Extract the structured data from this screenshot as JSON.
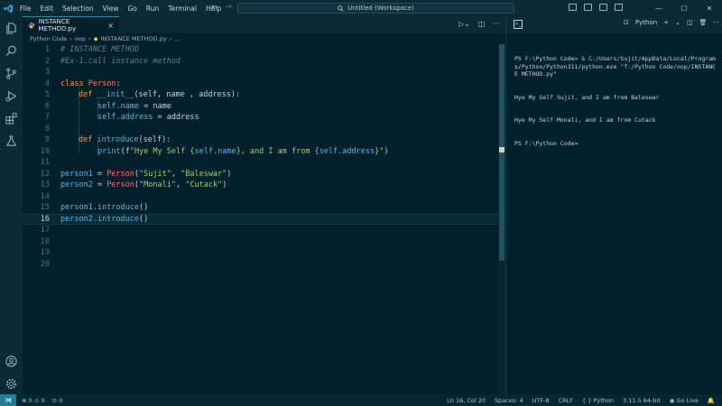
{
  "menu": [
    "File",
    "Edit",
    "Selection",
    "View",
    "Go",
    "Run",
    "Terminal",
    "Help"
  ],
  "command_center": "Untitled (Workspace)",
  "tab": {
    "label": "INSTANCE METHOD.py",
    "close": "×"
  },
  "breadcrumb": [
    "Python Code",
    "oop",
    "INSTANCE METHOD.py",
    "..."
  ],
  "code_lines": [
    {
      "n": "1"
    },
    {
      "n": "2"
    },
    {
      "n": "3"
    },
    {
      "n": "4"
    },
    {
      "n": "5"
    },
    {
      "n": "6"
    },
    {
      "n": "7"
    },
    {
      "n": "8"
    },
    {
      "n": "9"
    },
    {
      "n": "10"
    },
    {
      "n": "11"
    },
    {
      "n": "12"
    },
    {
      "n": "13"
    },
    {
      "n": "14"
    },
    {
      "n": "15"
    },
    {
      "n": "16"
    },
    {
      "n": "17"
    },
    {
      "n": "18"
    },
    {
      "n": "19"
    },
    {
      "n": "20"
    }
  ],
  "code": {
    "l1": "# INSTANCE METHOD",
    "l2": "#Ex-1.call instance method",
    "l4_kw": "class ",
    "l4_cls": "Person",
    "l4_end": ":",
    "l5_kw": "def ",
    "l5_fn": "__init__",
    "l5_rest": "(self, name , address):",
    "l6_self": "self",
    "l6_attr": ".name",
    "l6_rest": " = name",
    "l7_self": "self",
    "l7_attr": ".address",
    "l7_rest": " = address",
    "l9_kw": "def ",
    "l9_fn": "introduce",
    "l9_rest": "(self):",
    "l10_fn": "print",
    "l10_a": "(f",
    "l10_s1": "\"Hye My Self {",
    "l10_self1": "self.name",
    "l10_s2": "}, and I am from {",
    "l10_self2": "self.address",
    "l10_s3": "}\"",
    "l10_end": ")",
    "l12_var": "person1",
    "l12_eq": " = ",
    "l12_cls": "Person",
    "l12_a": "(",
    "l12_s1": "\"Sujit\"",
    "l12_c": ", ",
    "l12_s2": "\"Baleswar\"",
    "l12_end": ")",
    "l13_var": "person2",
    "l13_eq": " = ",
    "l13_cls": "Person",
    "l13_a": "(",
    "l13_s1": "\"Monali\"",
    "l13_c": ", ",
    "l13_s2": "\"Cutack\"",
    "l13_end": ")",
    "l15_var": "person1",
    "l15_fn": ".introduce",
    "l15_end": "()",
    "l16_var": "person2",
    "l16_fn": ".introduce",
    "l16_end": "()"
  },
  "panel": {
    "shell": "Python",
    "add": "+",
    "dropdown": "⌄",
    "more": "···",
    "close": "×"
  },
  "terminal_lines": [
    "PS F:\\Python Code> & C:/Users/Sujit/AppData/Local/Programs/Python/Python311/python.exe \"f:/Python Code/oop/INSTANCE METHOD.py\"",
    "Hye My Self Sujit, and I am from Baleswar",
    "Hye My Self Monali, and I am from Cutack",
    "PS F:\\Python Code>"
  ],
  "status": {
    "errors": "0",
    "warnings": "0",
    "ports": "0",
    "position": "Ln 16, Col 20",
    "spaces": "Spaces: 4",
    "encoding": "UTF-8",
    "eol": "CRLF",
    "language": "Python",
    "interpreter": "3.11.5 64-bit",
    "golive": "Go Live"
  },
  "colors": {
    "bg": "#00202b",
    "accent": "#2e8ba8",
    "keyword": "#e6a05a",
    "class": "#ff6b6b",
    "string": "#9fd07a"
  }
}
